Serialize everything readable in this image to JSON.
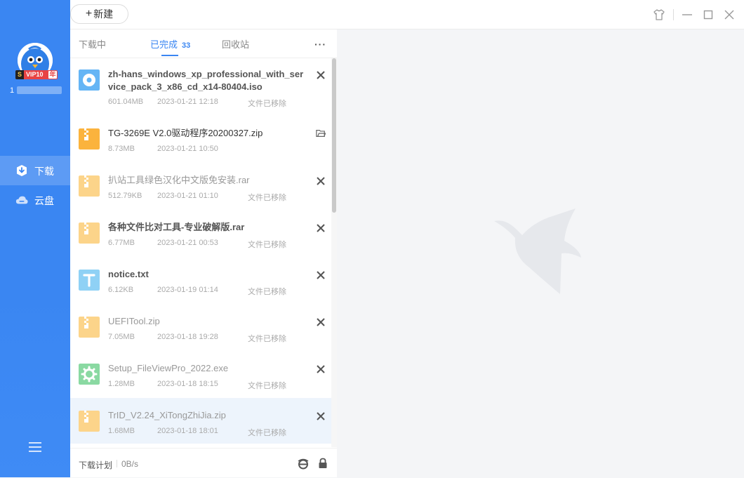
{
  "sidebar": {
    "vip_badge": {
      "s": "S",
      "text": "VIP10",
      "year": "年"
    },
    "username": "1",
    "nav": [
      {
        "label": "下载",
        "icon": "download-icon"
      },
      {
        "label": "云盘",
        "icon": "cloud-icon"
      }
    ],
    "menu_icon": "menu-icon"
  },
  "toolbar": {
    "new_label": "新建",
    "new_plus": "+"
  },
  "window_controls": [
    "skin-icon",
    "minimize-icon",
    "maximize-icon",
    "close-icon"
  ],
  "tabs": {
    "downloading": "下载中",
    "completed": "已完成",
    "completed_count": "33",
    "recycle": "回收站",
    "more": "···"
  },
  "files": [
    {
      "name": "zh-hans_windows_xp_professional_with_service_pack_3_x86_cd_x14-80404.iso",
      "size": "601.04MB",
      "date": "2023-01-21 12:18",
      "status": "文件已移除",
      "icon": "disc-icon",
      "action": "remove"
    },
    {
      "name": "TG-3269E V2.0驱动程序20200327.zip",
      "size": "8.73MB",
      "date": "2023-01-21 10:50",
      "status": "",
      "icon": "zip-icon",
      "action": "open-folder"
    },
    {
      "name": "扒站工具绿色汉化中文版免安装.rar",
      "size": "512.79KB",
      "date": "2023-01-21 01:10",
      "status": "文件已移除",
      "icon": "zip-icon",
      "action": "remove"
    },
    {
      "name": "各种文件比对工具-专业破解版.rar",
      "size": "6.77MB",
      "date": "2023-01-21 00:53",
      "status": "文件已移除",
      "icon": "zip-icon",
      "action": "remove"
    },
    {
      "name": "notice.txt",
      "size": "6.12KB",
      "date": "2023-01-19 01:14",
      "status": "文件已移除",
      "icon": "text-file-icon",
      "action": "remove"
    },
    {
      "name": "UEFITool.zip",
      "size": "7.05MB",
      "date": "2023-01-18 19:28",
      "status": "文件已移除",
      "icon": "zip-icon",
      "action": "remove"
    },
    {
      "name": "Setup_FileViewPro_2022.exe",
      "size": "1.28MB",
      "date": "2023-01-18 18:15",
      "status": "文件已移除",
      "icon": "exe-icon",
      "action": "remove"
    },
    {
      "name": "TrID_V2.24_XiTongZhiJia.zip",
      "size": "1.68MB",
      "date": "2023-01-18 18:01",
      "status": "文件已移除",
      "icon": "zip-icon",
      "action": "remove"
    }
  ],
  "footer": {
    "plan": "下载计划",
    "speed": "0B/s"
  },
  "colors": {
    "accent": "#3a86f2",
    "zip": "#fbb33d",
    "disc": "#65b5f5",
    "text_file": "#5ab8ef",
    "exe": "#5fc97e"
  }
}
